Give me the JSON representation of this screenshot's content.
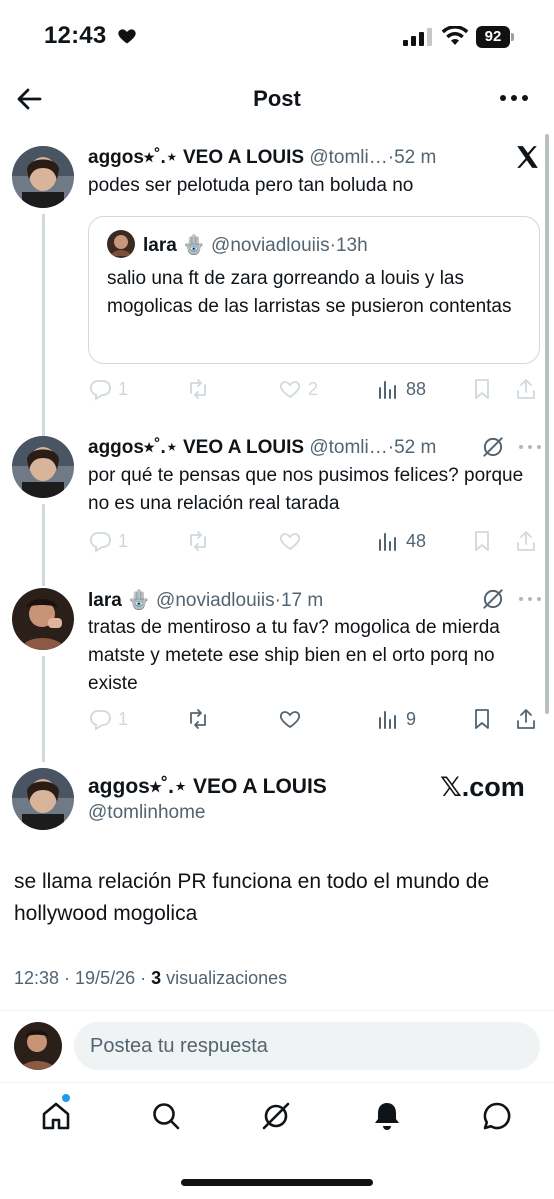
{
  "status_bar": {
    "time": "12:43",
    "battery": "92"
  },
  "header": {
    "title": "Post"
  },
  "tweets": [
    {
      "name": "aggos⭒˚.⋆ VEO A LOUIS",
      "handle": "@tomli…",
      "dot": "·",
      "time": "52 m",
      "text": "podes ser pelotuda pero tan boluda no",
      "quote": {
        "name": "lara 🪬",
        "handle": "@noviadlouiis",
        "dot": "·",
        "time": "13h",
        "text": "salio una ft de zara gorreando a louis y las mogolicas de las larristas se pusieron contentas"
      },
      "actions": {
        "replies": "1",
        "reposts": "",
        "likes": "2",
        "views": "88"
      }
    },
    {
      "name": "aggos⭒˚.⋆ VEO A LOUIS",
      "handle": "@tomli…",
      "dot": "·",
      "time": "52 m",
      "text": "por qué te pensas que nos pusimos felices? porque no es una relación real tarada",
      "actions": {
        "replies": "1",
        "reposts": "",
        "likes": "",
        "views": "48"
      }
    },
    {
      "name": "lara 🪬",
      "handle": "@noviadlouiis",
      "dot": "·",
      "time": "17 m",
      "text": "tratas de mentiroso a tu fav? mogolica de mierda matste y metete ese ship bien en el orto porq no existe",
      "actions": {
        "replies": "1",
        "reposts": "",
        "likes": "",
        "views": "9"
      }
    }
  ],
  "main_tweet": {
    "name": "aggos⭒˚.⋆ VEO A LOUIS",
    "handle": "@tomlinhome",
    "badge": "𝕏.com",
    "text": "se llama relación PR funciona en todo el mundo de hollywood mogolica",
    "meta_prefix": "12:38 · 19/5/26 · ",
    "views_count": "3",
    "views_label": " visualizaciones"
  },
  "reply": {
    "placeholder": "Postea tu respuesta"
  },
  "tabs": [
    "home",
    "search",
    "grok",
    "notifications",
    "messages"
  ],
  "colors": {
    "text": "#0f1419",
    "muted": "#536471",
    "accent": "#1d9bf0",
    "border": "#cfd9de"
  }
}
